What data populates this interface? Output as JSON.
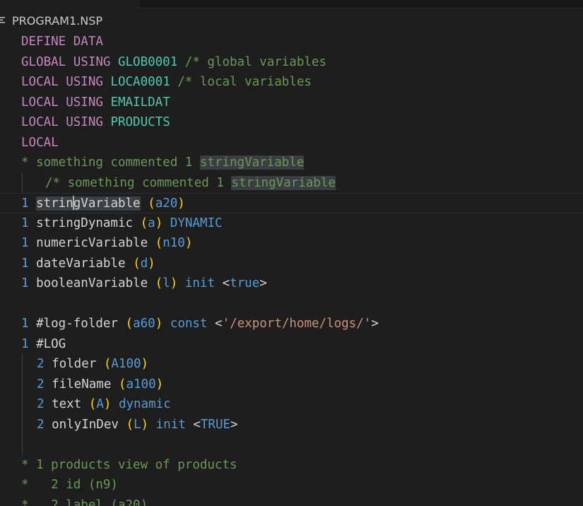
{
  "breadcrumb": {
    "file_name": "PROGRAM1.NSP",
    "icon": "hamburger-lines-icon"
  },
  "code": {
    "l1_kw": "DEFINE DATA",
    "l2_kw": "GLOBAL USING ",
    "l2_name": "GLOB0001",
    "l2_comment": " /* global variables",
    "l3_kw": "LOCAL USING ",
    "l3_name": "LOCA0001",
    "l3_comment": " /* local variables",
    "l4_kw": "LOCAL USING ",
    "l4_name": "EMAILDAT",
    "l5_kw": "LOCAL USING ",
    "l5_name": "PRODUCTS",
    "l6_kw": "LOCAL",
    "l7_comment": "* something commented 1 ",
    "l7_hl": "stringVariable",
    "l8_comment": "/* something commented 1 ",
    "l8_hl": "stringVariable",
    "l9_num": "1 ",
    "l9_var_a": "strin",
    "l9_var_b": "gVariable",
    "l9_fmt": "a20",
    "l10_num": "1 ",
    "l10_var": "stringDynamic",
    "l10_fmt": "a",
    "l10_kw": "DYNAMIC",
    "l11_num": "1 ",
    "l11_var": "numericVariable",
    "l11_fmt": "n10",
    "l12_num": "1 ",
    "l12_var": "dateVariable",
    "l12_fmt": "d",
    "l13_num": "1 ",
    "l13_var": "booleanVariable",
    "l13_fmt": "l",
    "l13_kw": "init",
    "l13_lt": "<",
    "l13_val": "true",
    "l13_gt": ">",
    "l15_num": "1 ",
    "l15_var": "#log-folder",
    "l15_fmt": "a60",
    "l15_kw": "const",
    "l15_lt": "<",
    "l15_str": "'/export/home/logs/'",
    "l15_gt": ">",
    "l16_num": "1 ",
    "l16_var": "#LOG",
    "l17_num": "2 ",
    "l17_var": "folder",
    "l17_fmt": "A100",
    "l18_num": "2 ",
    "l18_var": "fileName",
    "l18_fmt": "a100",
    "l19_num": "2 ",
    "l19_var": "text",
    "l19_fmt": "A",
    "l19_kw": "dynamic",
    "l20_num": "2 ",
    "l20_var": "onlyInDev",
    "l20_fmt": "L",
    "l20_kw": "init",
    "l20_lt": "<",
    "l20_val": "TRUE",
    "l20_gt": ">",
    "l22_comment": "* 1 products view of products",
    "l23_comment": "*   2 id (n9)",
    "l24_comment": "*   2 label (a20)"
  }
}
